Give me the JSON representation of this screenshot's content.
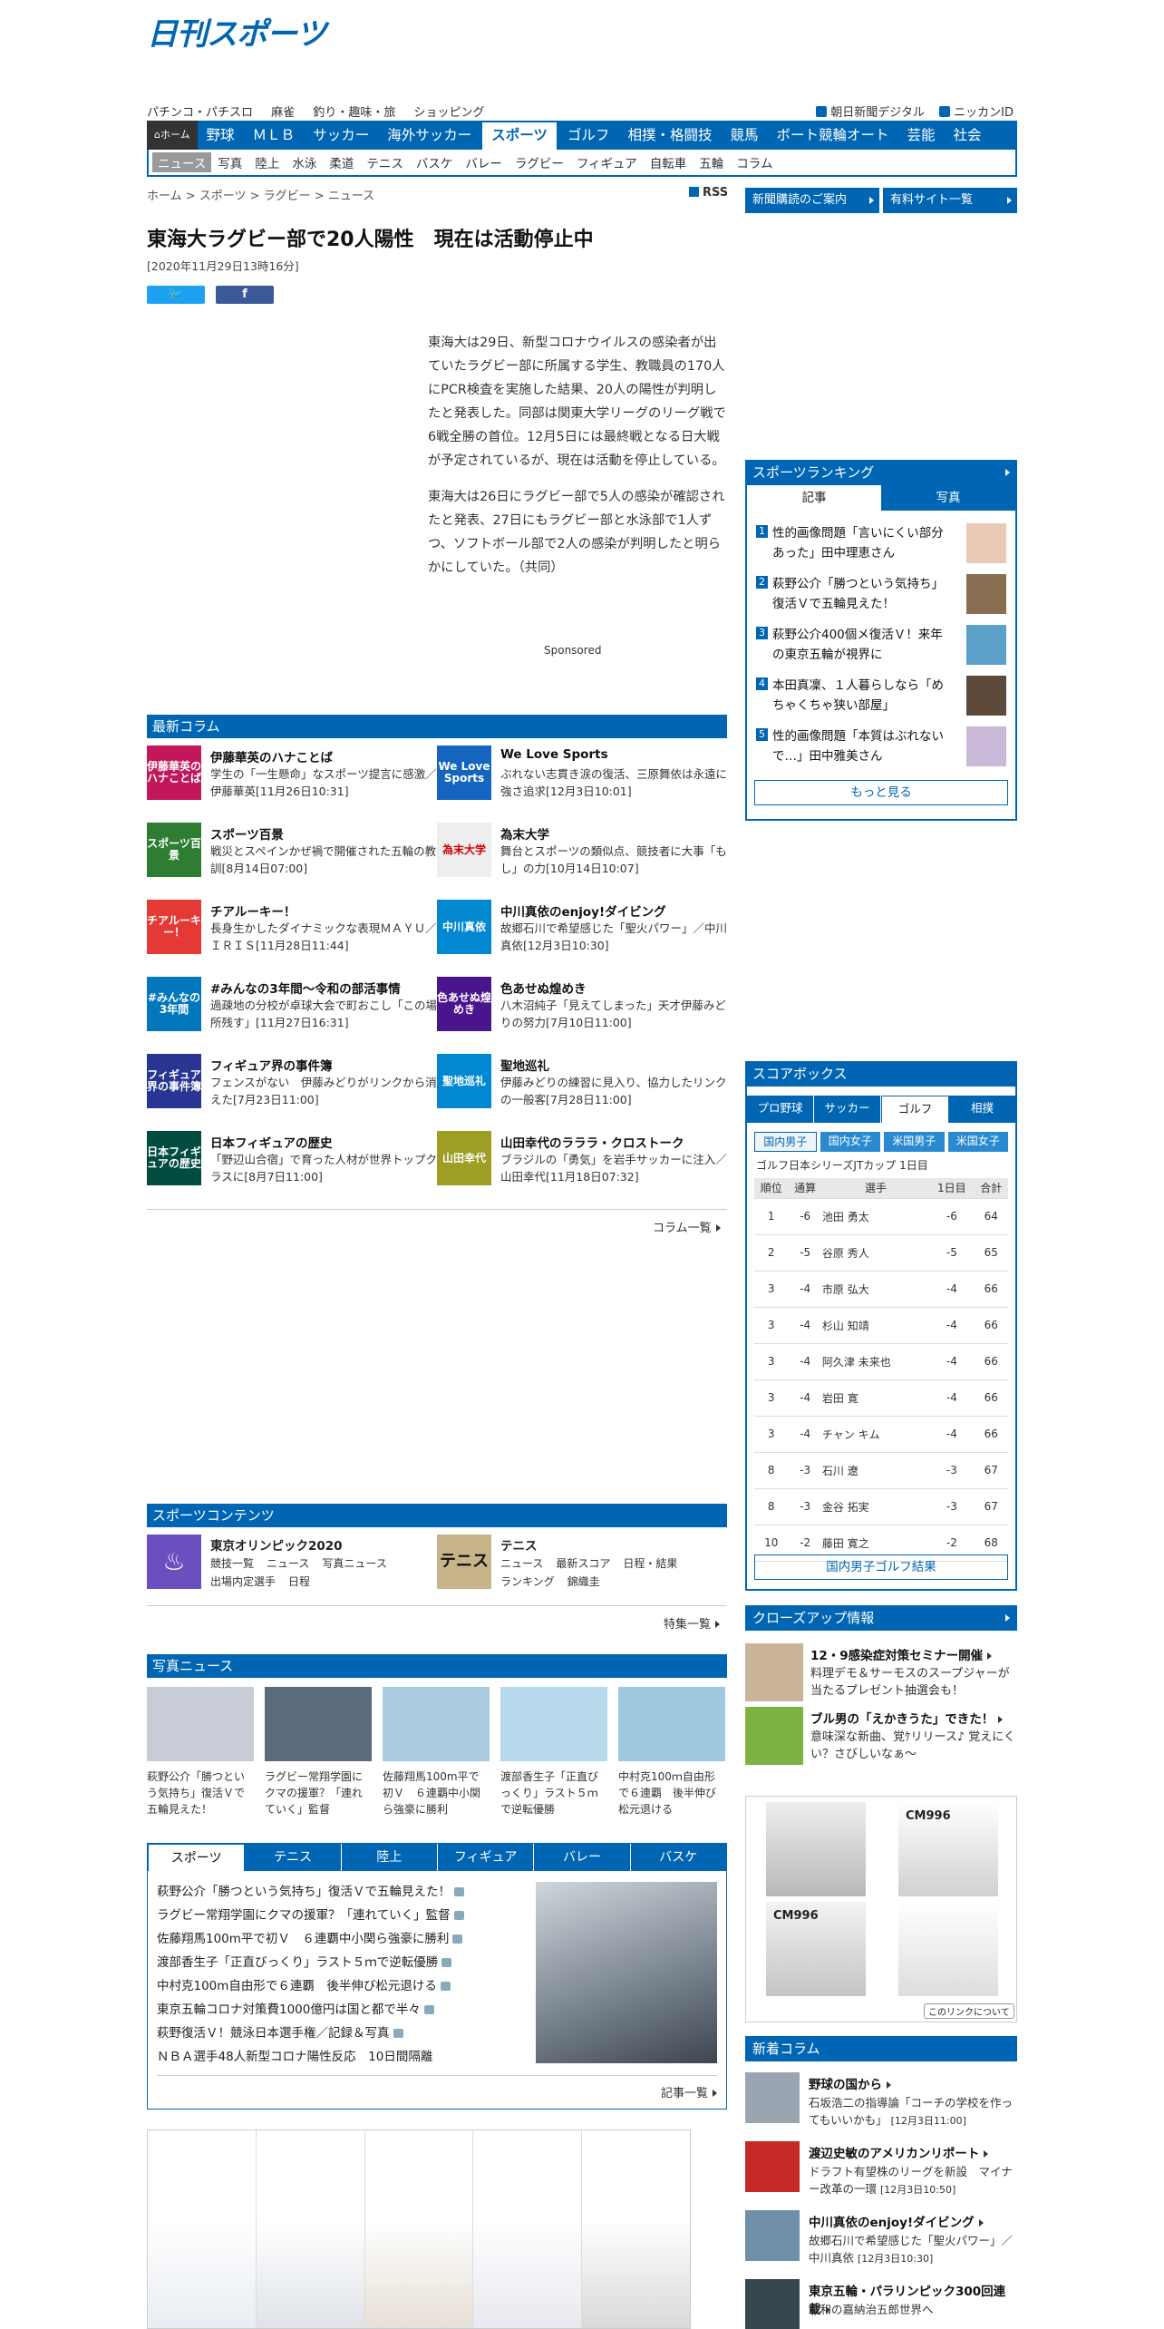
{
  "logo": "日刊スポーツ",
  "toplinks": [
    "パチンコ・パチスロ",
    "麻雀",
    "釣り・趣味・旅",
    "ショッピング"
  ],
  "rtoplinks": [
    "朝日新聞デジタル",
    "ニッカンID"
  ],
  "gnav": {
    "home": "ホーム",
    "items": [
      "野球",
      "ＭＬＢ",
      "サッカー",
      "海外サッカー",
      "スポーツ",
      "ゴルフ",
      "相撲・格闘技",
      "競馬",
      "ボート競輪オート",
      "芸能",
      "社会"
    ]
  },
  "subnav": [
    "ニュース",
    "写真",
    "陸上",
    "水泳",
    "柔道",
    "テニス",
    "バスケ",
    "バレー",
    "ラグビー",
    "フィギュア",
    "自転車",
    "五輪",
    "コラム"
  ],
  "breadcrumb": "ホーム > スポーツ > ラグビー > ニュース",
  "rss": "RSS",
  "rbtn1": "新聞購読のご案内",
  "rbtn2": "有料サイト一覧",
  "article": {
    "title": "東海大ラグビー部で20人陽性　現在は活動停止中",
    "date": "[2020年11月29日13時16分]",
    "p1": "東海大は29日、新型コロナウイルスの感染者が出ていたラグビー部に所属する学生、教職員の170人にPCR検査を実施した結果、20人の陽性が判明したと発表した。同部は関東大学リーグのリーグ戦で6戦全勝の首位。12月5日には最終戦となる日大戦が予定されているが、現在は活動を停止している。",
    "p2": "東海大は26日にラグビー部で5人の感染が確認されたと発表、27日にもラグビー部と水泳部で1人ずつ、ソフトボール部で2人の感染が判明したと明らかにしていた。（共同）"
  },
  "sponsored": "Sponsored",
  "columns": {
    "header": "最新コラム",
    "items": [
      {
        "img": "伊藤華英のハナことば",
        "title": "伊藤華英のハナことば",
        "desc": "学生の「一生懸命」なスポーツ提言に感激／伊藤華英[11月26日10:31]",
        "color": "#c2185b"
      },
      {
        "img": "We Love Sports",
        "title": "We Love Sports",
        "desc": "ぶれない志貫き涙の復活、三原舞依は永遠に強さ追求[12月3日10:01]",
        "color": "#1565c0"
      },
      {
        "img": "スポーツ百景",
        "title": "スポーツ百景",
        "desc": "戦災とスペインかぜ禍で開催された五輪の教訓[8月14日07:00]",
        "color": "#2e7d32"
      },
      {
        "img": "為末大学",
        "title": "為末大学",
        "desc": "舞台とスポーツの類似点、競技者に大事「もし」の力[10月14日10:07]",
        "color": "#eeeeee"
      },
      {
        "img": "チアルーキー！",
        "title": "チアルーキー！",
        "desc": "長身生かしたダイナミックな表現ＭＡＹＵ／ＩＲＩＳ[11月28日11:44]",
        "color": "#e53935"
      },
      {
        "img": "中川真依",
        "title": "中川真依のenjoy!ダイビング",
        "desc": "故郷石川で希望感じた「聖火パワー」／中川真依[12月3日10:30]",
        "color": "#0288d1"
      },
      {
        "img": "#みんなの3年間",
        "title": "#みんなの3年間～令和の部活事情",
        "desc": "過疎地の分校が卓球大会で町おこし「この場所残す」[11月27日16:31]",
        "color": "#0277bd"
      },
      {
        "img": "色あせぬ煌めき",
        "title": "色あせぬ煌めき",
        "desc": "八木沼純子「見えてしまった」天才伊藤みどりの努力[7月10日11:00]",
        "color": "#4a148c"
      },
      {
        "img": "フィギュア界の事件簿",
        "title": "フィギュア界の事件簿",
        "desc": "フェンスがない　伊藤みどりがリンクから消えた[7月23日11:00]",
        "color": "#283593"
      },
      {
        "img": "聖地巡礼",
        "title": "聖地巡礼",
        "desc": "伊藤みどりの練習に見入り、協力したリンクの一般客[7月28日11:00]",
        "color": "#0288d1"
      },
      {
        "img": "日本フィギュアの歴史",
        "title": "日本フィギュアの歴史",
        "desc": "「野辺山合宿」で育った人材が世界トップクラスに[8月7日11:00]",
        "color": "#004d40"
      },
      {
        "img": "山田幸代",
        "title": "山田幸代のラララ・クロストーク",
        "desc": "ブラジルの「勇気」を岩手サッカーに注入／山田幸代[11月18日07:32]",
        "color": "#9e9d24"
      }
    ],
    "more": "コラム一覧"
  },
  "sports_content": {
    "header": "スポーツコンテンツ",
    "items": [
      {
        "title": "東京オリンピック2020",
        "links": [
          "競技一覧",
          "ニュース",
          "写真ニュース",
          "出場内定選手",
          "日程"
        ]
      },
      {
        "title": "テニス",
        "links": [
          "ニュース",
          "最新スコア",
          "日程・結果",
          "ランキング",
          "錦織圭"
        ]
      }
    ],
    "more": "特集一覧"
  },
  "photo_news": {
    "header": "写真ニュース",
    "items": [
      {
        "cap": "萩野公介「勝つという気持ち」復活Ｖで五輪見えた！",
        "color": "#c7ccd6"
      },
      {
        "cap": "ラグビー常翔学園にクマの援軍？「連れていく」監督",
        "color": "#5a6b7c"
      },
      {
        "cap": "佐藤翔馬100m平で初Ｖ　６連覇中小関ら強豪に勝利",
        "color": "#a9cbe0"
      },
      {
        "cap": "渡部香生子「正直びっくり」ラスト５ｍで逆転優勝",
        "color": "#b7d9ec"
      },
      {
        "cap": "中村克100ｍ自由形で６連覇　後半伸び松元退ける",
        "color": "#9ec8e0"
      }
    ]
  },
  "tabs_news": {
    "tabs": [
      "スポーツ",
      "テニス",
      "陸上",
      "フィギュア",
      "バレー",
      "バスケ"
    ],
    "items": [
      "萩野公介「勝つという気持ち」復活Ｖで五輪見えた！",
      "ラグビー常翔学園にクマの援軍？「連れていく」監督",
      "佐藤翔馬100m平で初Ｖ　６連覇中小関ら強豪に勝利",
      "渡部香生子「正直びっくり」ラスト５ｍで逆転優勝",
      "中村克100m自由形で６連覇　後半伸び松元退ける",
      "東京五輪コロナ対策費1000億円は国と都で半々",
      "萩野復活Ｖ！競泳日本選手権／記録＆写真",
      "ＮＢＡ選手48人新型コロナ陽性反応　10日間隔離"
    ],
    "more": "記事一覧"
  },
  "ranking": {
    "header": "スポーツランキング",
    "tabs": [
      "記事",
      "写真"
    ],
    "items": [
      "性的画像問題「言いにくい部分あった」田中理恵さん",
      "萩野公介「勝つという気持ち」復活Ｖで五輪見えた！",
      "萩野公介400個メ復活Ｖ！来年の東京五輪が視界に",
      "本田真凜、１人暮らしなら「めちゃくちゃ狭い部屋」",
      "性的画像問題「本質はぶれないで…」田中雅美さん"
    ],
    "more": "もっと見る"
  },
  "scorebox": {
    "header": "スコアボックス",
    "tabs": [
      "プロ野球",
      "サッカー",
      "ゴルフ",
      "相撲"
    ],
    "subtabs": [
      "国内男子",
      "国内女子",
      "米国男子",
      "米国女子"
    ],
    "event": "ゴルフ日本シリーズJTカップ 1日目",
    "cols": [
      "順位",
      "通算",
      "選手",
      "1日目",
      "合計"
    ],
    "rows": [
      [
        "1",
        "-6",
        "池田 勇太",
        "-6",
        "64"
      ],
      [
        "2",
        "-5",
        "谷原 秀人",
        "-5",
        "65"
      ],
      [
        "3",
        "-4",
        "市原 弘大",
        "-4",
        "66"
      ],
      [
        "3",
        "-4",
        "杉山 知靖",
        "-4",
        "66"
      ],
      [
        "3",
        "-4",
        "阿久津 未来也",
        "-4",
        "66"
      ],
      [
        "3",
        "-4",
        "岩田 寛",
        "-4",
        "66"
      ],
      [
        "3",
        "-4",
        "チャン キム",
        "-4",
        "66"
      ],
      [
        "8",
        "-3",
        "石川 遼",
        "-3",
        "67"
      ],
      [
        "8",
        "-3",
        "金谷 拓実",
        "-3",
        "67"
      ],
      [
        "10",
        "-2",
        "藤田 寛之",
        "-2",
        "68"
      ]
    ],
    "more": "国内男子ゴルフ結果"
  },
  "closeup": {
    "header": "クローズアップ情報",
    "items": [
      {
        "title": "12・9感染症対策セミナー開催",
        "desc": "料理デモ＆サーモスのスープジャーが当たるプレゼント抽選会も！"
      },
      {
        "title": "ブル男の「えかきうた」できた！",
        "desc": "意味深な新曲、覚ｹリリース♪ 覚えにくい？さびしいなぁ～"
      }
    ]
  },
  "ad_shop": {
    "link": "このリンクについて",
    "sizes": [
      "CM996",
      "CM996"
    ]
  },
  "new_columns": {
    "header": "新着コラム",
    "items": [
      {
        "title": "野球の国から",
        "desc": "石坂浩二の指導論「コーチの学校を作ってもいいかも」",
        "date": "[12月3日11:00]"
      },
      {
        "title": "渡辺史敏のアメリカンリポート",
        "desc": "ドラフト有望株のリーグを新設　マイナー改革の一環",
        "date": "[12月3日10:50]"
      },
      {
        "title": "中川真依のenjoy!ダイビング",
        "desc": "故郷石川で希望感じた「聖火パワー」／中川真依",
        "date": "[12月3日10:30]"
      },
      {
        "title": "東京五輪・パラリンピック300回連載",
        "desc": "令和の嘉納治五郎世界へ",
        "date": ""
      }
    ]
  }
}
